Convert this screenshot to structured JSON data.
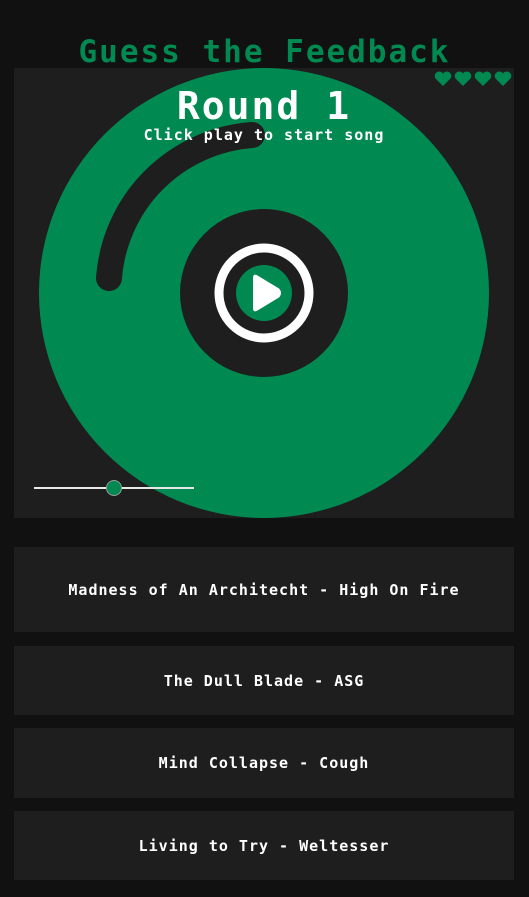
{
  "title": "Guess the Feedback",
  "lives": {
    "count": 4,
    "icon": "heart-icon",
    "color": "#008a52"
  },
  "round": {
    "label": "Round 1",
    "hint": "Click play to start song"
  },
  "player": {
    "play_icon": "play-icon",
    "volume": 0.5,
    "colors": {
      "disc": "#008a52",
      "groove": "#1e1e1e",
      "ring": "#ffffff"
    }
  },
  "options": [
    {
      "label": "Madness of An Architecht - High On Fire"
    },
    {
      "label": "The Dull Blade - ASG"
    },
    {
      "label": "Mind Collapse - Cough"
    },
    {
      "label": "Living to Try - Weltesser"
    }
  ]
}
